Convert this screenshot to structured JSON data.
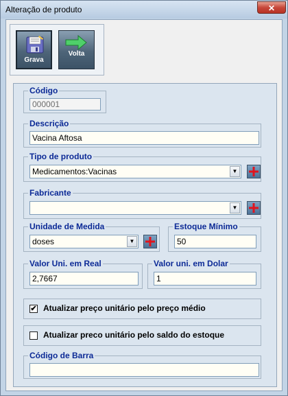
{
  "window": {
    "title": "Alteração de produto",
    "close_label": "✕"
  },
  "toolbar": {
    "save_label": "Grava",
    "back_label": "Volta"
  },
  "form": {
    "codigo": {
      "label": "Código",
      "value": "000001"
    },
    "descricao": {
      "label": "Descrição",
      "value": "Vacina Aftosa"
    },
    "tipo": {
      "label": "Tipo de produto",
      "value": "Medicamentos:Vacinas"
    },
    "fabricante": {
      "label": "Fabricante",
      "value": ""
    },
    "unidade": {
      "label": "Unidade de Medida",
      "value": "doses"
    },
    "estoque_minimo": {
      "label": "Estoque Mínimo",
      "value": "50"
    },
    "valor_real": {
      "label": "Valor Uni. em Real",
      "value": "2,7667"
    },
    "valor_dolar": {
      "label": "Valor uni. em Dolar",
      "value": "1"
    },
    "check_medio": {
      "label": "Atualizar preço unitário pelo preço médio",
      "checked": true,
      "mark": "✔"
    },
    "check_saldo": {
      "label": "Atualizar preco unitário pelo saldo do estoque",
      "checked": false
    },
    "barcode": {
      "label": "Código de Barra",
      "value": ""
    }
  },
  "icons": {
    "save": "floppy-disk-icon",
    "back": "arrow-right-icon",
    "add": "plus-icon",
    "dropdown": "chevron-down-icon"
  },
  "colors": {
    "label_blue": "#0c2a96",
    "field_bg": "#fffef5",
    "panel_bg": "#dbe5ef",
    "plus_red": "#e0141e"
  }
}
